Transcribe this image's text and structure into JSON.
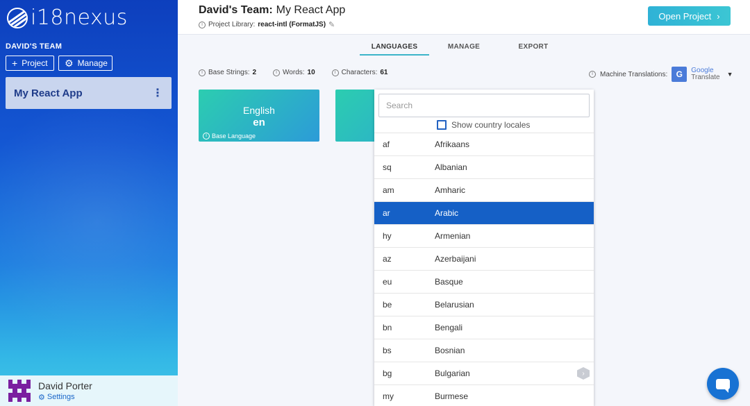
{
  "sidebar": {
    "logo_text": "i18nexus",
    "team_label": "DAVID'S TEAM",
    "project_button": "Project",
    "manage_button": "Manage",
    "project_name": "My React App",
    "user_name": "David Porter",
    "settings_label": "Settings"
  },
  "header": {
    "team": "David's Team:",
    "project": "My React App",
    "library_label": "Project Library:",
    "library_value": "react-intl (FormatJS)",
    "open_button": "Open Project"
  },
  "tabs": [
    "LANGUAGES",
    "MANAGE",
    "EXPORT"
  ],
  "stats": {
    "base_strings_label": "Base Strings:",
    "base_strings_value": "2",
    "words_label": "Words:",
    "words_value": "10",
    "characters_label": "Characters:",
    "characters_value": "61"
  },
  "machine_translation": {
    "label": "Machine Translations:",
    "provider_line1": "Google",
    "provider_line2": "Translate"
  },
  "base_card": {
    "name": "English",
    "code": "en",
    "badge": "Base Language"
  },
  "dropdown": {
    "search_placeholder": "Search",
    "locale_toggle": "Show country locales",
    "languages": [
      {
        "code": "af",
        "name": "Afrikaans"
      },
      {
        "code": "sq",
        "name": "Albanian"
      },
      {
        "code": "am",
        "name": "Amharic"
      },
      {
        "code": "ar",
        "name": "Arabic"
      },
      {
        "code": "hy",
        "name": "Armenian"
      },
      {
        "code": "az",
        "name": "Azerbaijani"
      },
      {
        "code": "eu",
        "name": "Basque"
      },
      {
        "code": "be",
        "name": "Belarusian"
      },
      {
        "code": "bn",
        "name": "Bengali"
      },
      {
        "code": "bs",
        "name": "Bosnian"
      },
      {
        "code": "bg",
        "name": "Bulgarian"
      },
      {
        "code": "my",
        "name": "Burmese"
      }
    ],
    "selected_code": "ar"
  },
  "colors": {
    "accent": "#1560c6",
    "tab_underline": "#3bb4c9",
    "chat": "#1872d3"
  }
}
